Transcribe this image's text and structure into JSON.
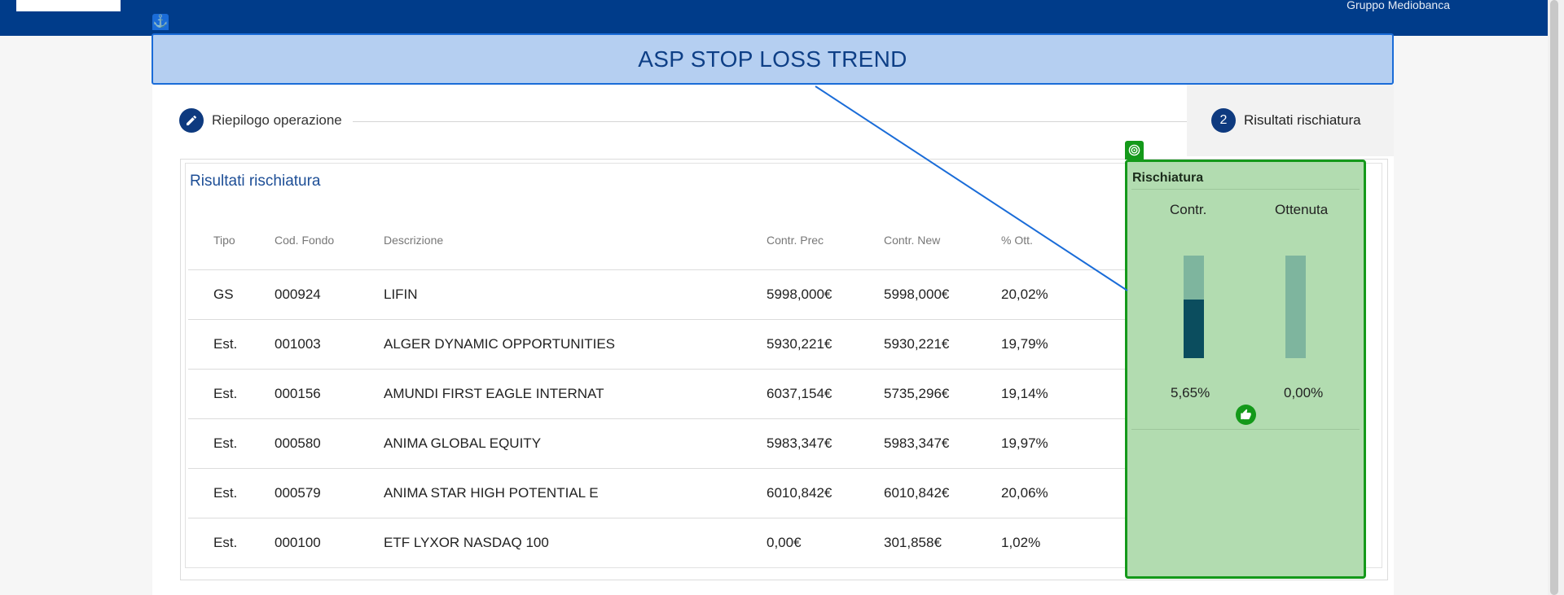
{
  "header": {
    "brand_text": "Gruppo Mediobanca"
  },
  "banner": {
    "title": "ASP STOP LOSS TREND",
    "anchor_glyph": "⚓"
  },
  "stepper": {
    "steps": [
      {
        "number": "",
        "icon": "pencil-icon",
        "label": "Riepilogo operazione"
      },
      {
        "number": "2",
        "label": "Risultati rischiatura"
      }
    ]
  },
  "results": {
    "title": "Risultati rischiatura",
    "columns": [
      "Tipo",
      "Cod. Fondo",
      "Descrizione",
      "Contr. Prec",
      "Contr. New",
      "% Ott."
    ],
    "rows": [
      [
        "GS",
        "000924",
        "LIFIN",
        "5998,000€",
        "5998,000€",
        "20,02%"
      ],
      [
        "Est.",
        "001003",
        "ALGER DYNAMIC OPPORTUNITIES",
        "5930,221€",
        "5930,221€",
        "19,79%"
      ],
      [
        "Est.",
        "000156",
        "AMUNDI FIRST EAGLE INTERNAT",
        "6037,154€",
        "5735,296€",
        "19,14%"
      ],
      [
        "Est.",
        "000580",
        "ANIMA GLOBAL EQUITY",
        "5983,347€",
        "5983,347€",
        "19,97%"
      ],
      [
        "Est.",
        "000579",
        "ANIMA STAR HIGH POTENTIAL E",
        "6010,842€",
        "6010,842€",
        "20,06%"
      ],
      [
        "Est.",
        "000100",
        "ETF LYXOR NASDAQ 100",
        "0,00€",
        "301,858€",
        "1,02%"
      ]
    ]
  },
  "rischiatura": {
    "title": "Rischiatura",
    "contr_label": "Contr.",
    "ottenuta_label": "Ottenuta",
    "contr_value": "5,65%",
    "ottenuta_value": "0,00%",
    "contr_fill_fraction": 0.57,
    "ottenuta_fill_fraction": 0.0,
    "status_icon": "thumbs-up-icon"
  },
  "colors": {
    "header": "#003c8a",
    "banner_border": "#1a6cd8",
    "overlay_border": "#14991a",
    "bar_fill": "#0b4d5e",
    "bar_track": "#7eb59e"
  }
}
